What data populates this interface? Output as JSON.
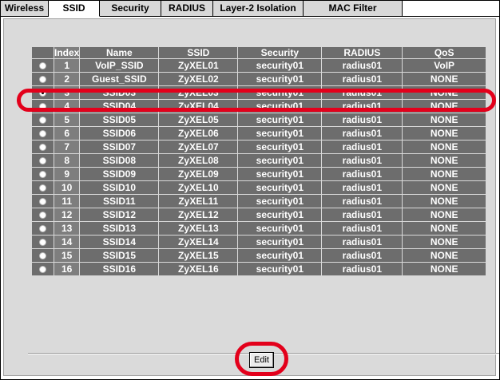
{
  "tabs": [
    {
      "label": "Wireless",
      "active": false
    },
    {
      "label": "SSID",
      "active": true
    },
    {
      "label": "Security",
      "active": false
    },
    {
      "label": "RADIUS",
      "active": false
    },
    {
      "label": "Layer-2 Isolation",
      "active": false
    },
    {
      "label": "MAC Filter",
      "active": false
    }
  ],
  "table": {
    "columns": [
      "",
      "Index",
      "Name",
      "SSID",
      "Security",
      "RADIUS",
      "QoS"
    ],
    "rows": [
      {
        "index": "1",
        "name": "VoIP_SSID",
        "ssid": "ZyXEL01",
        "security": "security01",
        "radius": "radius01",
        "qos": "VoIP",
        "selected": false
      },
      {
        "index": "2",
        "name": "Guest_SSID",
        "ssid": "ZyXEL02",
        "security": "security01",
        "radius": "radius01",
        "qos": "NONE",
        "selected": false
      },
      {
        "index": "3",
        "name": "SSID03",
        "ssid": "ZyXEL03",
        "security": "security01",
        "radius": "radius01",
        "qos": "NONE",
        "selected": true
      },
      {
        "index": "4",
        "name": "SSID04",
        "ssid": "ZyXEL04",
        "security": "security01",
        "radius": "radius01",
        "qos": "NONE",
        "selected": false
      },
      {
        "index": "5",
        "name": "SSID05",
        "ssid": "ZyXEL05",
        "security": "security01",
        "radius": "radius01",
        "qos": "NONE",
        "selected": false
      },
      {
        "index": "6",
        "name": "SSID06",
        "ssid": "ZyXEL06",
        "security": "security01",
        "radius": "radius01",
        "qos": "NONE",
        "selected": false
      },
      {
        "index": "7",
        "name": "SSID07",
        "ssid": "ZyXEL07",
        "security": "security01",
        "radius": "radius01",
        "qos": "NONE",
        "selected": false
      },
      {
        "index": "8",
        "name": "SSID08",
        "ssid": "ZyXEL08",
        "security": "security01",
        "radius": "radius01",
        "qos": "NONE",
        "selected": false
      },
      {
        "index": "9",
        "name": "SSID09",
        "ssid": "ZyXEL09",
        "security": "security01",
        "radius": "radius01",
        "qos": "NONE",
        "selected": false
      },
      {
        "index": "10",
        "name": "SSID10",
        "ssid": "ZyXEL10",
        "security": "security01",
        "radius": "radius01",
        "qos": "NONE",
        "selected": false
      },
      {
        "index": "11",
        "name": "SSID11",
        "ssid": "ZyXEL11",
        "security": "security01",
        "radius": "radius01",
        "qos": "NONE",
        "selected": false
      },
      {
        "index": "12",
        "name": "SSID12",
        "ssid": "ZyXEL12",
        "security": "security01",
        "radius": "radius01",
        "qos": "NONE",
        "selected": false
      },
      {
        "index": "13",
        "name": "SSID13",
        "ssid": "ZyXEL13",
        "security": "security01",
        "radius": "radius01",
        "qos": "NONE",
        "selected": false
      },
      {
        "index": "14",
        "name": "SSID14",
        "ssid": "ZyXEL14",
        "security": "security01",
        "radius": "radius01",
        "qos": "NONE",
        "selected": false
      },
      {
        "index": "15",
        "name": "SSID15",
        "ssid": "ZyXEL15",
        "security": "security01",
        "radius": "radius01",
        "qos": "NONE",
        "selected": false
      },
      {
        "index": "16",
        "name": "SSID16",
        "ssid": "ZyXEL16",
        "security": "security01",
        "radius": "radius01",
        "qos": "NONE",
        "selected": false
      }
    ]
  },
  "actions": {
    "edit_label": "Edit"
  },
  "colors": {
    "highlight": "#e3001b",
    "header": "#6d6d6d",
    "panel": "#dadada"
  }
}
